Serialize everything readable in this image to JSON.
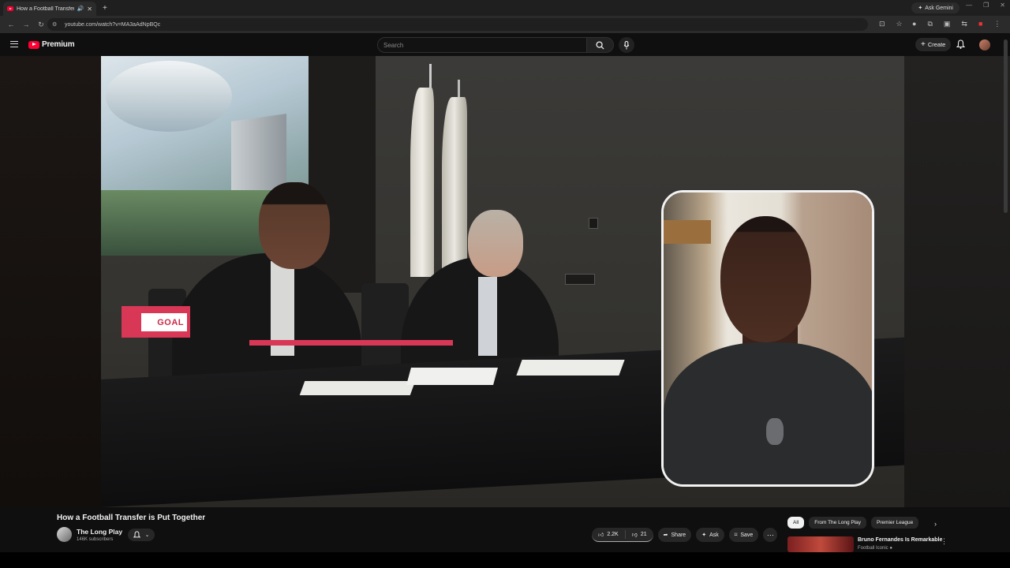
{
  "browser": {
    "tab_title": "How a Football Transfer is P",
    "new_tab": "+",
    "ask_gemini": "Ask Gemini",
    "url": "youtube.com/watch?v=MA3aAdNpBQc"
  },
  "youtube": {
    "brand": "Premium",
    "search_placeholder": "Search",
    "create_label": "Create"
  },
  "video": {
    "overlay_logo": "GOAL"
  },
  "meta": {
    "title": "How a Football Transfer is Put Together",
    "channel": "The Long Play",
    "subscribers": "146K subscribers",
    "likes": "2.2K",
    "dislikes": "21",
    "share": "Share",
    "ask": "Ask",
    "save": "Save"
  },
  "chips": [
    "All",
    "From The Long Play",
    "Premier League"
  ],
  "recommendation": {
    "title": "Bruno Fernandes Is Remarkable",
    "channel": "Football Iconic"
  },
  "icons": [
    "search-icon",
    "mic-icon",
    "bell-icon",
    "like-icon",
    "dislike-icon",
    "share-icon",
    "sparkle-icon",
    "bookmark-icon",
    "more-icon",
    "chevron-right-icon"
  ],
  "colors": {
    "youtube_red": "#ff0033",
    "goal_pink": "#d93756",
    "background": "#0f0f0f"
  }
}
